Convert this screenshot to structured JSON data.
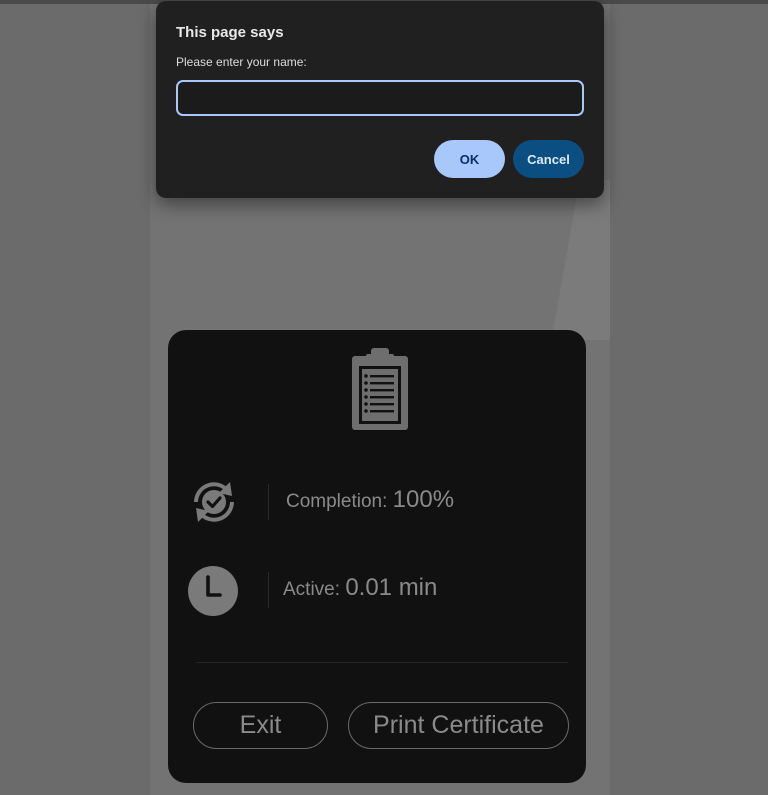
{
  "dialog": {
    "title": "This page says",
    "message": "Please enter your name:",
    "input_value": "",
    "input_placeholder": "",
    "ok_label": "OK",
    "cancel_label": "Cancel"
  },
  "card": {
    "icon": "clipboard-icon",
    "completion": {
      "icon": "refresh-check-icon",
      "label": "Completion: ",
      "value": "100%"
    },
    "active": {
      "icon": "clock-icon",
      "label": "Active: ",
      "value": "0.01 min"
    },
    "exit_label": "Exit",
    "print_label": "Print Certificate"
  },
  "colors": {
    "overlay": "#6b6b6b",
    "card_bg": "#111111",
    "dialog_bg": "#202020",
    "accent": "#a8c7fa",
    "cancel_bg": "#0b4f82"
  }
}
